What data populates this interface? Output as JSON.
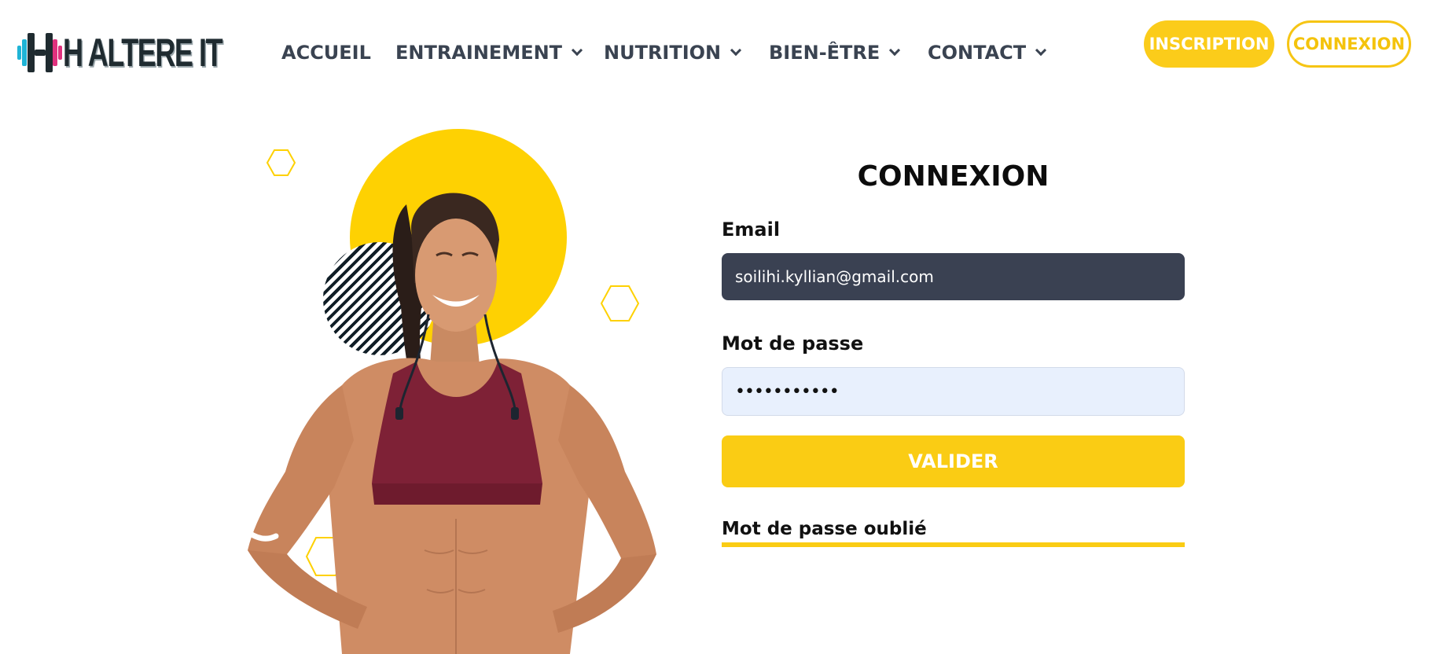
{
  "header": {
    "logo_text": "H ALTERE IT",
    "nav": [
      {
        "label": "ACCUEIL",
        "has_dropdown": false
      },
      {
        "label": "ENTRAINEMENT",
        "has_dropdown": true
      },
      {
        "label": "NUTRITION",
        "has_dropdown": true
      },
      {
        "label": "BIEN-ÊTRE",
        "has_dropdown": true
      },
      {
        "label": "CONTACT",
        "has_dropdown": true
      }
    ],
    "inscription_label": "INSCRIPTION",
    "connexion_label": "CONNEXION"
  },
  "login": {
    "title": "CONNEXION",
    "email_label": "Email",
    "email_value": "soilihi.kyllian@gmail.com",
    "password_label": "Mot de passe",
    "password_value": "•••••••••••",
    "submit_label": "VALIDER",
    "forgot_label": "Mot de passe oublié"
  },
  "colors": {
    "accent_yellow": "#facc14",
    "dark_input": "#3a4152",
    "password_bg": "#e8f0fd",
    "nav_text": "#3a4351",
    "logo_cyan": "#1fb4d6",
    "logo_pink": "#e0317e"
  },
  "icons": {
    "nav_dropdown": "chevron-down-icon"
  }
}
